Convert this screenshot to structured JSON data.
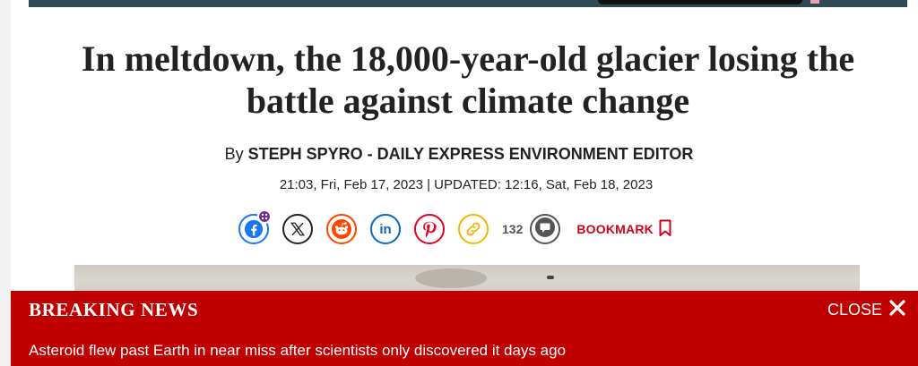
{
  "article": {
    "headline": "In meltdown, the 18,000-year-old glacier losing the battle against climate change",
    "byline_prefix": "By",
    "author": "STEPH SPYRO - DAILY EXPRESS ENVIRONMENT EDITOR",
    "dateline": "21:03, Fri, Feb 17, 2023 | UPDATED: 12:16, Sat, Feb 18, 2023"
  },
  "share": {
    "icons": [
      "facebook-icon",
      "x-icon",
      "reddit-icon",
      "linkedin-icon",
      "pinterest-icon",
      "copy-link-icon",
      "comment-icon",
      "bookmark-icon"
    ],
    "comment_count": "132",
    "bookmark_label": "BOOKMARK"
  },
  "breaking": {
    "title": "BREAKING NEWS",
    "close_label": "CLOSE",
    "story": "Asteroid flew past Earth in near miss after scientists only discovered it days ago"
  },
  "colors": {
    "breaking_bg": "#c00000",
    "bookmark": "#d0021b",
    "facebook": "#1877f2",
    "reddit": "#ff4500",
    "linkedin": "#0a66c2",
    "pinterest": "#e60023",
    "link": "#f2b600"
  }
}
